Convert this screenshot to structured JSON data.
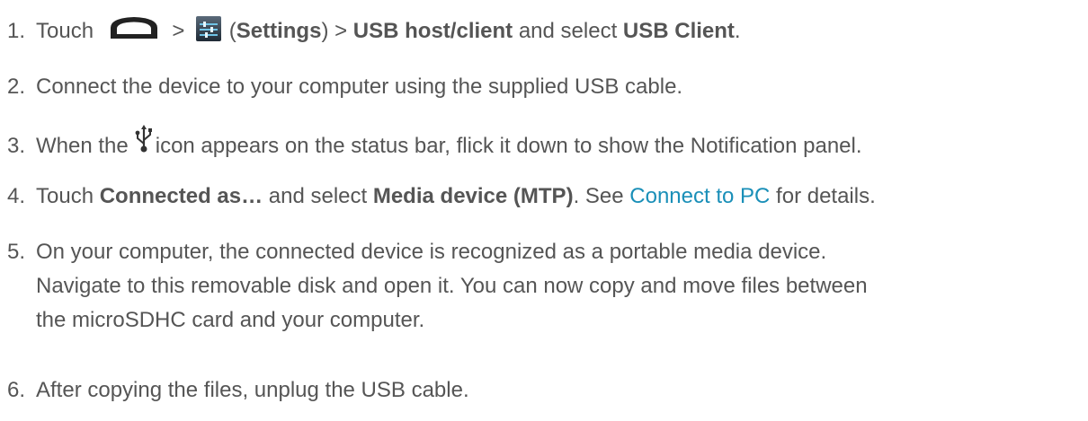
{
  "steps": [
    {
      "num": "1.",
      "t1": "Touch",
      "t2": ">",
      "t3": "(",
      "settings": "Settings",
      "t4": ") >",
      "usb_host": "USB host/client",
      "t5": "and select",
      "usb_client": "USB Client",
      "t6": "."
    },
    {
      "num": "2.",
      "text": "Connect the device to your computer using the supplied USB cable."
    },
    {
      "num": "3.",
      "t1": "When the",
      "t2": "icon appears on the status bar, flick it down to show the Notification panel."
    },
    {
      "num": "4.",
      "t1": "Touch",
      "connected_as": "Connected as…",
      "t2": "and select",
      "media_device": "Media device (MTP)",
      "t3": ". See",
      "link": "Connect to PC",
      "t4": "for details."
    },
    {
      "num": "5.",
      "lines": [
        "On your computer, the connected device is recognized as a portable media device.",
        "Navigate to this removable disk and open it. You can now copy and move files between",
        "the microSDHC card and your computer."
      ]
    },
    {
      "num": "6.",
      "text": "After copying the files, unplug the USB cable."
    }
  ],
  "icons": {
    "home": "home-icon",
    "settings": "settings-icon",
    "usb": "usb-icon"
  },
  "colors": {
    "text": "#555555",
    "link": "#1a8fb8"
  }
}
